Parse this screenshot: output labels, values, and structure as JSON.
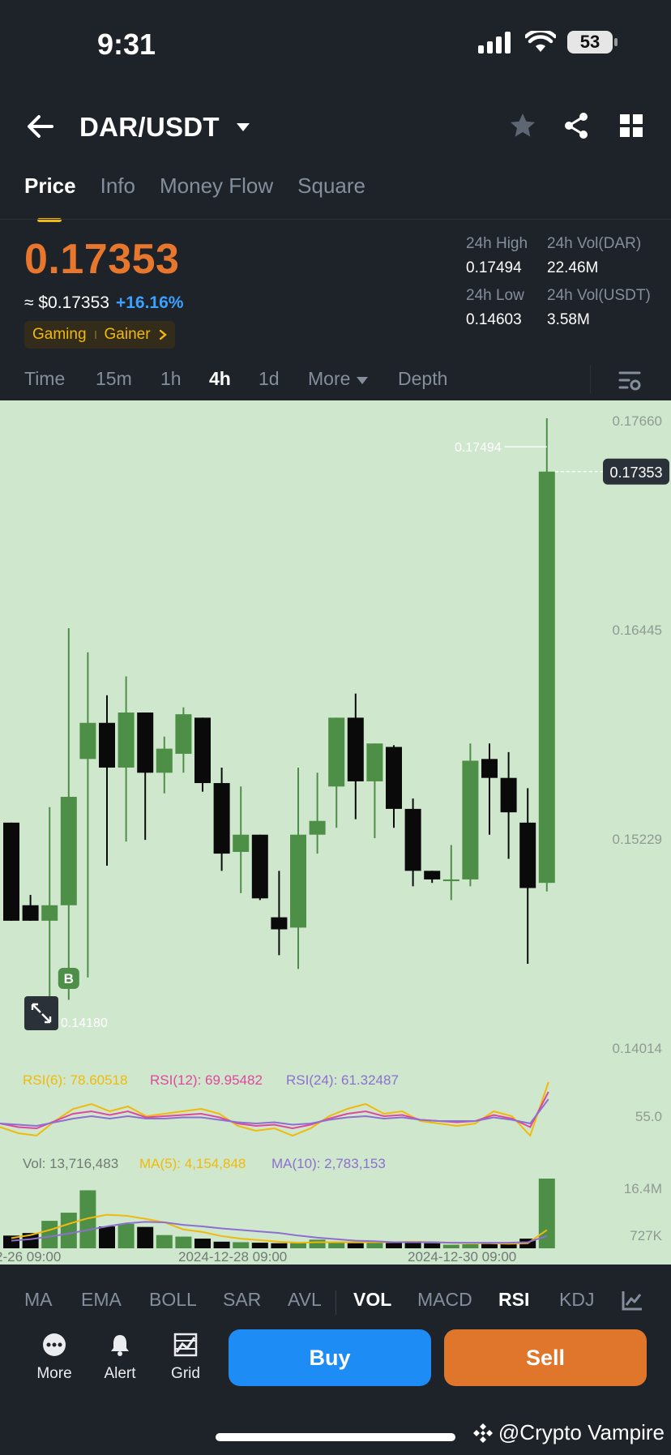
{
  "status_bar": {
    "time": "9:31",
    "battery": "53"
  },
  "header": {
    "pair": "DAR/USDT"
  },
  "tabs": [
    {
      "label": "Price",
      "active": true
    },
    {
      "label": "Info",
      "active": false
    },
    {
      "label": "Money Flow",
      "active": false
    },
    {
      "label": "Square",
      "active": false
    }
  ],
  "price": {
    "last": "0.17353",
    "usd": "≈ $0.17353",
    "change": "+16.16%"
  },
  "tags": [
    "Gaming",
    "Gainer"
  ],
  "stats": {
    "high_label": "24h High",
    "high_value": "0.17494",
    "vol_dar_label": "24h Vol(DAR)",
    "vol_dar_value": "22.46M",
    "low_label": "24h Low",
    "low_value": "0.14603",
    "vol_usdt_label": "24h Vol(USDT)",
    "vol_usdt_value": "3.58M"
  },
  "intervals": [
    "Time",
    "15m",
    "1h",
    "4h",
    "1d",
    "More",
    "Depth"
  ],
  "active_interval": "4h",
  "chart_data": {
    "type": "candlestick",
    "price_axis": [
      "0.17660",
      "0.16445",
      "0.15229",
      "0.14014"
    ],
    "price_range": [
      0.14014,
      0.1766
    ],
    "current_price_label": "0.17353",
    "high_marker": "0.17494",
    "low_marker": "0.14180",
    "buy_marker": "B",
    "candles": [
      {
        "o": 0.1531,
        "h": 0.1531,
        "l": 0.1474,
        "c": 0.1474
      },
      {
        "o": 0.1483,
        "h": 0.1489,
        "l": 0.1474,
        "c": 0.1474
      },
      {
        "o": 0.1474,
        "h": 0.154,
        "l": 0.142,
        "c": 0.1483
      },
      {
        "o": 0.1483,
        "h": 0.1644,
        "l": 0.1428,
        "c": 0.1546
      },
      {
        "o": 0.1568,
        "h": 0.163,
        "l": 0.1441,
        "c": 0.1589
      },
      {
        "o": 0.1589,
        "h": 0.1605,
        "l": 0.1506,
        "c": 0.1563
      },
      {
        "o": 0.1563,
        "h": 0.1616,
        "l": 0.152,
        "c": 0.1595
      },
      {
        "o": 0.1595,
        "h": 0.1578,
        "l": 0.1521,
        "c": 0.156
      },
      {
        "o": 0.156,
        "h": 0.1581,
        "l": 0.1548,
        "c": 0.1574
      },
      {
        "o": 0.1571,
        "h": 0.1598,
        "l": 0.156,
        "c": 0.1594
      },
      {
        "o": 0.1592,
        "h": 0.159,
        "l": 0.1549,
        "c": 0.1554
      },
      {
        "o": 0.1554,
        "h": 0.1563,
        "l": 0.1503,
        "c": 0.1513
      },
      {
        "o": 0.1514,
        "h": 0.1552,
        "l": 0.149,
        "c": 0.1524
      },
      {
        "o": 0.1524,
        "h": 0.1511,
        "l": 0.1486,
        "c": 0.1487
      },
      {
        "o": 0.1476,
        "h": 0.1503,
        "l": 0.1454,
        "c": 0.1469
      },
      {
        "o": 0.147,
        "h": 0.1563,
        "l": 0.1446,
        "c": 0.1524
      },
      {
        "o": 0.1524,
        "h": 0.156,
        "l": 0.1513,
        "c": 0.1532
      },
      {
        "o": 0.1552,
        "h": 0.1589,
        "l": 0.1528,
        "c": 0.1592
      },
      {
        "o": 0.1592,
        "h": 0.1606,
        "l": 0.1533,
        "c": 0.1555
      },
      {
        "o": 0.1555,
        "h": 0.157,
        "l": 0.1522,
        "c": 0.1577
      },
      {
        "o": 0.1575,
        "h": 0.1576,
        "l": 0.1528,
        "c": 0.1539
      },
      {
        "o": 0.1539,
        "h": 0.1545,
        "l": 0.1494,
        "c": 0.1503
      },
      {
        "o": 0.1503,
        "h": 0.15,
        "l": 0.1496,
        "c": 0.1498
      },
      {
        "o": 0.1497,
        "h": 0.1518,
        "l": 0.1486,
        "c": 0.1498
      },
      {
        "o": 0.1498,
        "h": 0.1577,
        "l": 0.1494,
        "c": 0.1567
      },
      {
        "o": 0.1568,
        "h": 0.1577,
        "l": 0.1524,
        "c": 0.1557
      },
      {
        "o": 0.1557,
        "h": 0.1572,
        "l": 0.151,
        "c": 0.1537
      },
      {
        "o": 0.1531,
        "h": 0.1551,
        "l": 0.1449,
        "c": 0.1493
      },
      {
        "o": 0.1496,
        "h": 0.1766,
        "l": 0.1491,
        "c": 0.1735
      }
    ],
    "x_labels": [
      "2-26 09:00",
      "2024-12-28 09:00",
      "2024-12-30 09:00"
    ],
    "rsi": {
      "rsi6_label": "RSI(6): 78.60518",
      "rsi12_label": "RSI(12): 69.95482",
      "rsi24_label": "RSI(24): 61.32487",
      "axis_label": "55.0",
      "rsi6": [
        47,
        42,
        40,
        52,
        62,
        66,
        60,
        64,
        56,
        58,
        60,
        62,
        58,
        48,
        44,
        46,
        40,
        46,
        56,
        62,
        66,
        58,
        60,
        52,
        50,
        48,
        50,
        60,
        56,
        40,
        84
      ],
      "rsi12": [
        50,
        47,
        46,
        52,
        58,
        60,
        57,
        60,
        55,
        56,
        57,
        58,
        55,
        50,
        48,
        49,
        46,
        49,
        54,
        58,
        60,
        56,
        57,
        53,
        52,
        51,
        52,
        57,
        54,
        47,
        76
      ],
      "rsi24": [
        50,
        49,
        48,
        51,
        54,
        56,
        54,
        56,
        54,
        54,
        55,
        55,
        53,
        51,
        50,
        51,
        49,
        50,
        53,
        55,
        56,
        54,
        55,
        53,
        52,
        52,
        52,
        55,
        53,
        50,
        70
      ]
    },
    "volume": {
      "vol_label": "Vol: 13,716,483",
      "ma5_label": "MA(5): 4,154,848",
      "ma10_label": "MA(10): 2,783,153",
      "axis_top": "16.4M",
      "axis_bottom": "727K",
      "values": [
        2.5,
        3.0,
        5.4,
        7.0,
        11.4,
        4.3,
        4.8,
        4.2,
        2.6,
        2.3,
        1.9,
        1.3,
        1.2,
        1.1,
        1.0,
        1.0,
        1.7,
        1.2,
        1.0,
        1.1,
        1.2,
        1.4,
        1.0,
        0.7,
        0.8,
        0.9,
        0.9,
        1.9,
        13.7
      ],
      "ma5": [
        2.0,
        2.6,
        3.6,
        4.8,
        5.9,
        6.6,
        6.4,
        5.8,
        5.1,
        3.7,
        3.2,
        2.4,
        1.9,
        1.6,
        1.3,
        1.1,
        1.2,
        1.2,
        1.2,
        1.2,
        1.2,
        1.3,
        1.2,
        1.1,
        1.0,
        1.0,
        0.9,
        1.0,
        3.6
      ],
      "ma10": [
        1.5,
        1.8,
        2.3,
        2.9,
        3.6,
        4.3,
        4.9,
        5.2,
        5.1,
        4.6,
        4.3,
        3.9,
        3.6,
        3.3,
        3.0,
        2.5,
        2.1,
        1.8,
        1.5,
        1.4,
        1.2,
        1.2,
        1.2,
        1.1,
        1.1,
        1.1,
        1.1,
        1.2,
        2.4
      ]
    }
  },
  "indicators": [
    "MA",
    "EMA",
    "BOLL",
    "SAR",
    "AVL",
    "VOL",
    "MACD",
    "RSI",
    "KDJ"
  ],
  "active_indicators": [
    "VOL",
    "RSI"
  ],
  "bottom_bar": {
    "more": "More",
    "alert": "Alert",
    "grid": "Grid",
    "buy": "Buy",
    "sell": "Sell"
  },
  "watermark": "@Crypto Vampire",
  "colors": {
    "up": "#4e8f47",
    "down": "#0a0a0a",
    "chart_bg": "#cfe8cd",
    "price": "#e8772e",
    "change": "#3ba0ff",
    "rsi6": "#f0b90b",
    "rsi12": "#e0479e",
    "rsi24": "#8e6fd0"
  }
}
